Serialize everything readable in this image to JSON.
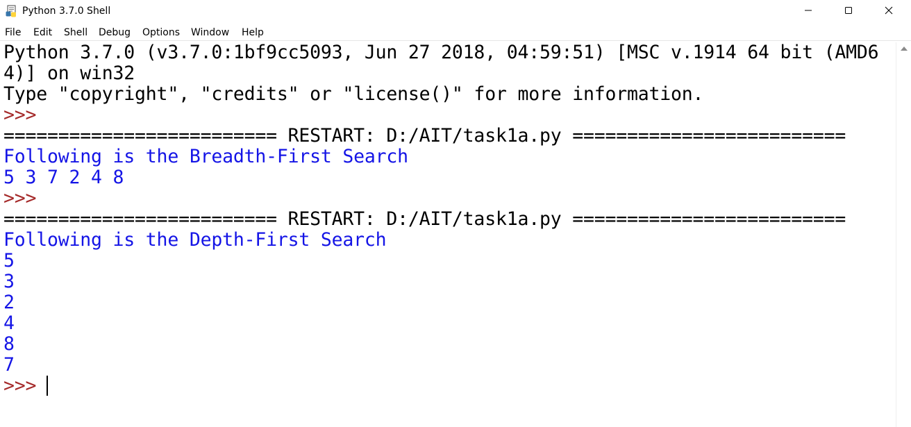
{
  "window": {
    "title": "Python 3.7.0 Shell"
  },
  "menu": {
    "items": [
      "File",
      "Edit",
      "Shell",
      "Debug",
      "Options",
      "Window",
      "Help"
    ]
  },
  "shell": {
    "lines": [
      {
        "text": "Python 3.7.0 (v3.7.0:1bf9cc5093, Jun 27 2018, 04:59:51) [MSC v.1914 64 bit (AMD6",
        "kind": "banner"
      },
      {
        "text": "4)] on win32",
        "kind": "banner"
      },
      {
        "text": "Type \"copyright\", \"credits\" or \"license()\" for more information.",
        "kind": "banner"
      },
      {
        "text": ">>>",
        "kind": "prompt"
      },
      {
        "text": "========================= RESTART: D:/AIT/task1a.py =========================",
        "kind": "restart"
      },
      {
        "text": "Following is the Breadth-First Search",
        "kind": "output"
      },
      {
        "text": "5 3 7 2 4 8",
        "kind": "output"
      },
      {
        "text": ">>>",
        "kind": "prompt"
      },
      {
        "text": "========================= RESTART: D:/AIT/task1a.py =========================",
        "kind": "restart"
      },
      {
        "text": "Following is the Depth-First Search",
        "kind": "output"
      },
      {
        "text": "5",
        "kind": "output"
      },
      {
        "text": "3",
        "kind": "output"
      },
      {
        "text": "2",
        "kind": "output"
      },
      {
        "text": "4",
        "kind": "output"
      },
      {
        "text": "8",
        "kind": "output"
      },
      {
        "text": "7",
        "kind": "output"
      },
      {
        "text": ">>> ",
        "kind": "prompt"
      }
    ]
  },
  "icons": {
    "app": "python-shell-icon",
    "minimize": "minimize-icon",
    "maximize": "maximize-icon",
    "close": "close-icon",
    "scroll_up": "scroll-up-arrow-icon"
  },
  "colors": {
    "banner": "#000000",
    "output": "#1414e6",
    "prompt": "#a52a2a"
  }
}
